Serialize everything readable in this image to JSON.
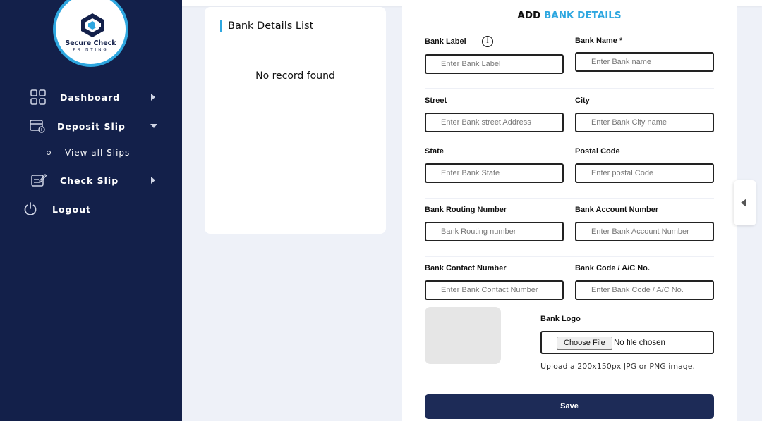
{
  "brand": {
    "line1": "Secure Check",
    "line2": "PRINTING",
    "accent_color": "#2ea7e0",
    "navy_color": "#13204a"
  },
  "sidebar": {
    "items": [
      {
        "label": "Dashboard",
        "icon": "grid-icon",
        "arrow": "right"
      },
      {
        "label": "Deposit Slip",
        "icon": "deposit-slip-icon",
        "arrow": "down"
      },
      {
        "label": "View all Slips",
        "icon": "bullet",
        "sub": true
      },
      {
        "label": "Check Slip",
        "icon": "check-slip-icon",
        "arrow": "right"
      },
      {
        "label": "Logout",
        "icon": "power-icon"
      }
    ]
  },
  "list_panel": {
    "title": "Bank Details List",
    "empty_text": "No record found"
  },
  "form": {
    "title_prefix": "ADD",
    "title_highlight": "BANK DETAILS",
    "fields": {
      "bank_label": {
        "label": "Bank Label",
        "placeholder": "Enter Bank Label"
      },
      "bank_name": {
        "label": "Bank Name *",
        "placeholder": "Enter Bank name"
      },
      "street": {
        "label": "Street",
        "placeholder": "Enter Bank street Address"
      },
      "city": {
        "label": "City",
        "placeholder": "Enter Bank City name"
      },
      "state": {
        "label": "State",
        "placeholder": "Enter Bank State"
      },
      "postal_code": {
        "label": "Postal Code",
        "placeholder": "Enter postal Code"
      },
      "routing_number": {
        "label": "Bank Routing Number",
        "placeholder": "Bank Routing number"
      },
      "account_number": {
        "label": "Bank Account Number",
        "placeholder": "Enter Bank Account Number"
      },
      "contact_number": {
        "label": "Bank Contact Number",
        "placeholder": "Enter Bank Contact Number"
      },
      "bank_code": {
        "label": "Bank Code / A/C No.",
        "placeholder": "Enter Bank Code / A/C No."
      }
    },
    "logo": {
      "label": "Bank Logo",
      "choose_button": "Choose File",
      "file_status": "No file chosen",
      "hint": "Upload a 200x150px JPG or PNG image."
    },
    "save_label": "Save",
    "info_glyph": "i"
  }
}
